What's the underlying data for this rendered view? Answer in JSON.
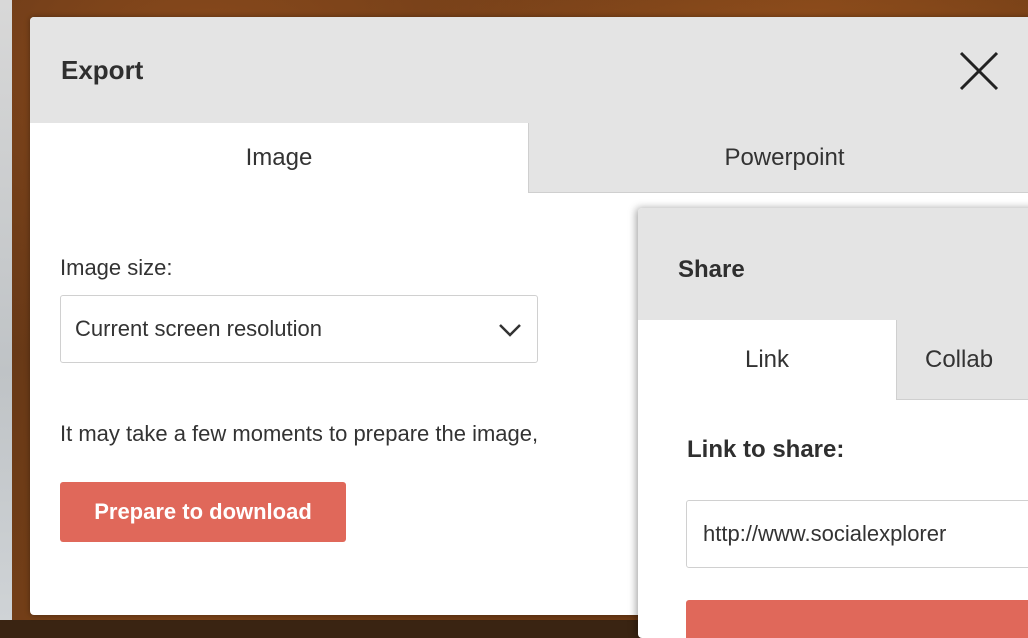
{
  "export_dialog": {
    "title": "Export",
    "close_icon": "close-icon",
    "tabs": [
      {
        "label": "Image",
        "active": true
      },
      {
        "label": "Powerpoint",
        "active": false
      }
    ],
    "image_size_label": "Image size:",
    "image_size_value": "Current screen resolution",
    "note": "It may take a few moments to prepare the image,",
    "prepare_button": "Prepare to download"
  },
  "share_dialog": {
    "title": "Share",
    "tabs": [
      {
        "label": "Link",
        "active": true
      },
      {
        "label": "Collab",
        "active": false
      }
    ],
    "link_label": "Link to share:",
    "link_value": "http://www.socialexplorer"
  },
  "colors": {
    "accent": "#e0685a",
    "header_bg": "#e4e4e4",
    "text": "#333333"
  }
}
